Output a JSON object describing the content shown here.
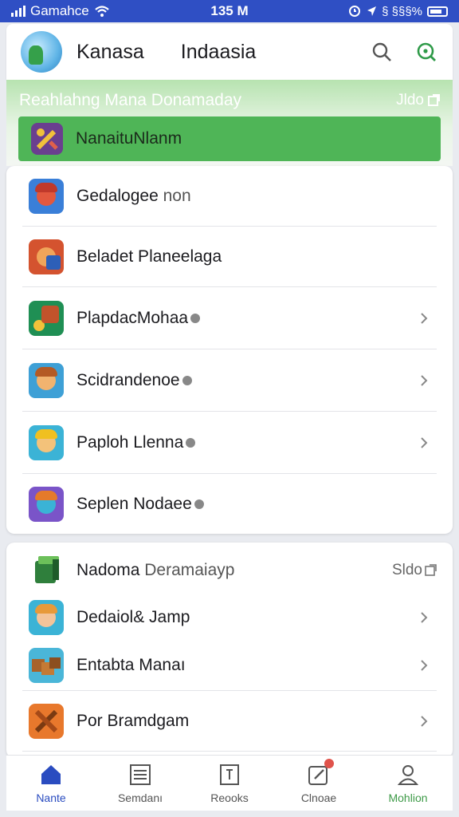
{
  "status_bar": {
    "carrier": "Gamahce",
    "time": "135 M",
    "indicators": "§ §§§%",
    "icons": [
      "signal-icon",
      "wifi-icon",
      "alarm-icon",
      "location-icon",
      "bluetooth-icon",
      "battery-icon"
    ]
  },
  "header": {
    "title": "Kanasa",
    "subtitle": "Indaasia",
    "icons": [
      "avatar",
      "search-icon",
      "zoom-icon"
    ]
  },
  "banner": {
    "heading": "Reahlahng Mana Donamaday",
    "right_label": "Jldo",
    "bar_label": "NanaituNlanm",
    "bar_icon": "tools-icon"
  },
  "list1": {
    "items": [
      {
        "label": "Gedalogee",
        "muted": "non",
        "dot": false,
        "chevron": false
      },
      {
        "label": "Beladet Planeelaga",
        "muted": "",
        "dot": false,
        "chevron": false
      },
      {
        "label": "PlapdacMohaa",
        "muted": "",
        "dot": true,
        "chevron": true
      },
      {
        "label": "Scidrandenoe",
        "muted": "",
        "dot": true,
        "chevron": true
      },
      {
        "label": "Paploh Llenna",
        "muted": "",
        "dot": true,
        "chevron": true
      },
      {
        "label": "Seplen Nodaee",
        "muted": "",
        "dot": true,
        "chevron": false
      }
    ]
  },
  "list2": {
    "header_label": "Nadoma",
    "header_muted": "Deramaiayp",
    "header_right": "Sldo",
    "items": [
      {
        "label": "Dedaiol& Jamp",
        "chevron": true
      },
      {
        "label": "Entabta Manaı",
        "chevron": true
      },
      {
        "label": "Por Bramdgam",
        "chevron": true
      }
    ]
  },
  "bottom_nav": {
    "items": [
      {
        "label": "Nante",
        "icon": "home-icon"
      },
      {
        "label": "Semdanı",
        "icon": "list-icon"
      },
      {
        "label": "Reooks",
        "icon": "book-icon"
      },
      {
        "label": "Clnoae",
        "icon": "edit-icon"
      },
      {
        "label": "Mohlion",
        "icon": "profile-icon"
      }
    ]
  },
  "colors": {
    "status_bar": "#2f4fc4",
    "banner_bar": "#4fb557",
    "nav_active": "#2a4cc0",
    "profile_green": "#3e9a48"
  }
}
